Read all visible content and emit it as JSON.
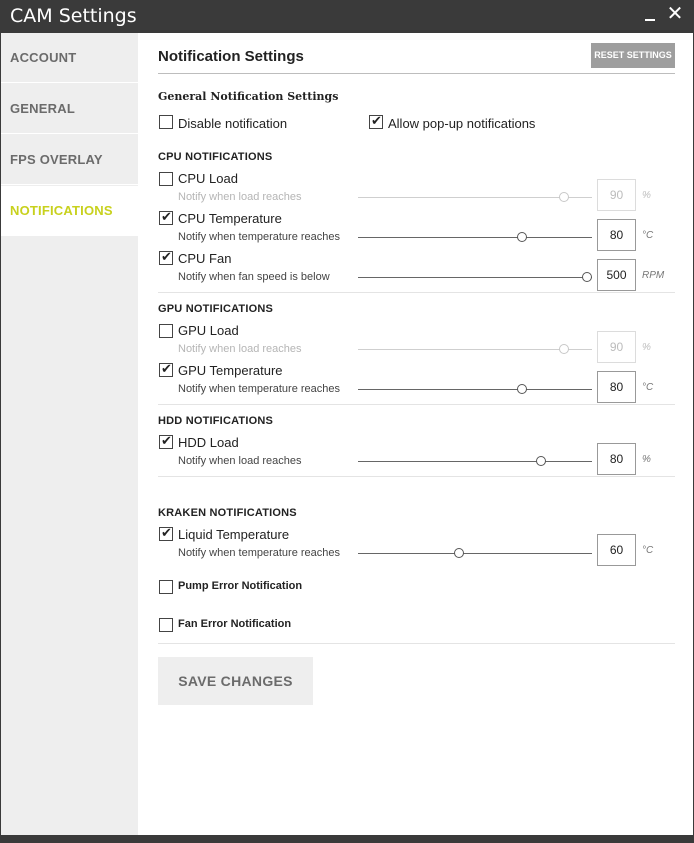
{
  "window": {
    "title": "CAM Settings"
  },
  "sidebar": {
    "items": [
      {
        "label": "ACCOUNT",
        "active": false
      },
      {
        "label": "GENERAL",
        "active": false
      },
      {
        "label": "FPS OVERLAY",
        "active": false
      },
      {
        "label": "NOTIFICATIONS",
        "active": true
      }
    ]
  },
  "page": {
    "title": "Notification Settings",
    "reset_label": "RESET SETTINGS",
    "general": {
      "heading": "General Notification Settings",
      "disable_label": "Disable notification",
      "disable_checked": false,
      "popup_label": "Allow pop-up notifications",
      "popup_checked": true
    },
    "cpu": {
      "heading": "CPU NOTIFICATIONS",
      "load": {
        "label": "CPU Load",
        "checked": false,
        "note": "Notify when load reaches",
        "value": "90",
        "unit": "%",
        "level": 0.88
      },
      "temp": {
        "label": "CPU Temperature",
        "checked": true,
        "note": "Notify when temperature reaches",
        "value": "80",
        "unit": "°C",
        "level": 0.7
      },
      "fan": {
        "label": "CPU Fan",
        "checked": true,
        "note": "Notify when fan speed is below",
        "value": "500",
        "unit": "RPM",
        "level": 0.98
      }
    },
    "gpu": {
      "heading": "GPU NOTIFICATIONS",
      "load": {
        "label": "GPU Load",
        "checked": false,
        "note": "Notify when load reaches",
        "value": "90",
        "unit": "%",
        "level": 0.88
      },
      "temp": {
        "label": "GPU Temperature",
        "checked": true,
        "note": "Notify when temperature reaches",
        "value": "80",
        "unit": "°C",
        "level": 0.7
      }
    },
    "hdd": {
      "heading": "HDD NOTIFICATIONS",
      "load": {
        "label": "HDD Load",
        "checked": true,
        "note": "Notify when load reaches",
        "value": "80",
        "unit": "%",
        "level": 0.78
      }
    },
    "kraken": {
      "heading": "KRAKEN NOTIFICATIONS",
      "liquid": {
        "label": "Liquid Temperature",
        "checked": true,
        "note": "Notify when temperature reaches",
        "value": "60",
        "unit": "°C",
        "level": 0.43
      },
      "pump_label": "Pump Error Notification",
      "pump_checked": false,
      "fan_label": "Fan Error Notification",
      "fan_checked": false
    },
    "save_label": "SAVE CHANGES"
  },
  "colors": {
    "accent": "#c8d11d",
    "titlebar": "#3a3a3a",
    "sidebar": "#eeeeee"
  }
}
